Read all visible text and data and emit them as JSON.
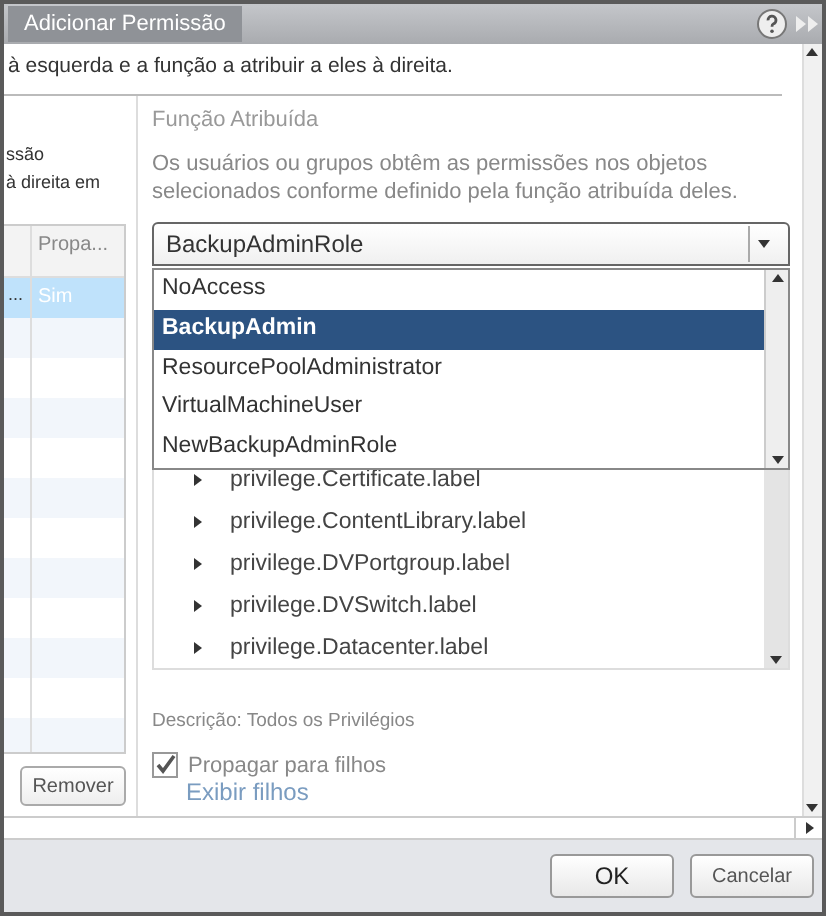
{
  "window": {
    "title": "Adicionar Permissão"
  },
  "intro": "à esquerda e a função a atribuir a eles à direita.",
  "left_panel": {
    "text_lines": [
      "ssão",
      "à direita em"
    ],
    "table": {
      "column_2": "Propa...",
      "rows": [
        {
          "column_1": "...",
          "column_2": "Sim",
          "selected": true
        }
      ]
    },
    "remove_button": "Remover"
  },
  "role_panel": {
    "heading": "Função Atribuída",
    "description": "Os usuários ou grupos obtêm as permissões nos objetos selecionados conforme definido pela função atribuída deles.",
    "role_dropdown": {
      "value": "BackupAdminRole",
      "expanded": true,
      "options": [
        {
          "label": "NoAccess",
          "selected": false
        },
        {
          "label": "BackupAdmin",
          "selected": true
        },
        {
          "label": "ResourcePoolAdministrator",
          "selected": false
        },
        {
          "label": "VirtualMachineUser",
          "selected": false
        },
        {
          "label": "NewBackupAdminRole",
          "selected": false
        }
      ]
    },
    "privileges": [
      {
        "label": "privilege.Certificate.label",
        "expanded": false
      },
      {
        "label": "privilege.ContentLibrary.label",
        "expanded": false
      },
      {
        "label": "privilege.DVPortgroup.label",
        "expanded": false
      },
      {
        "label": "privilege.DVSwitch.label",
        "expanded": false
      },
      {
        "label": "privilege.Datacenter.label",
        "expanded": false
      }
    ],
    "summary": "Descrição: Todos os Privilégios",
    "propagate": {
      "label": "Propagar para filhos",
      "checked": true
    },
    "show_children_link": "Exibir filhos"
  },
  "buttons": [
    {
      "label": "OK",
      "kind": "primary"
    },
    {
      "label": "Cancelar",
      "kind": "secondary"
    }
  ]
}
